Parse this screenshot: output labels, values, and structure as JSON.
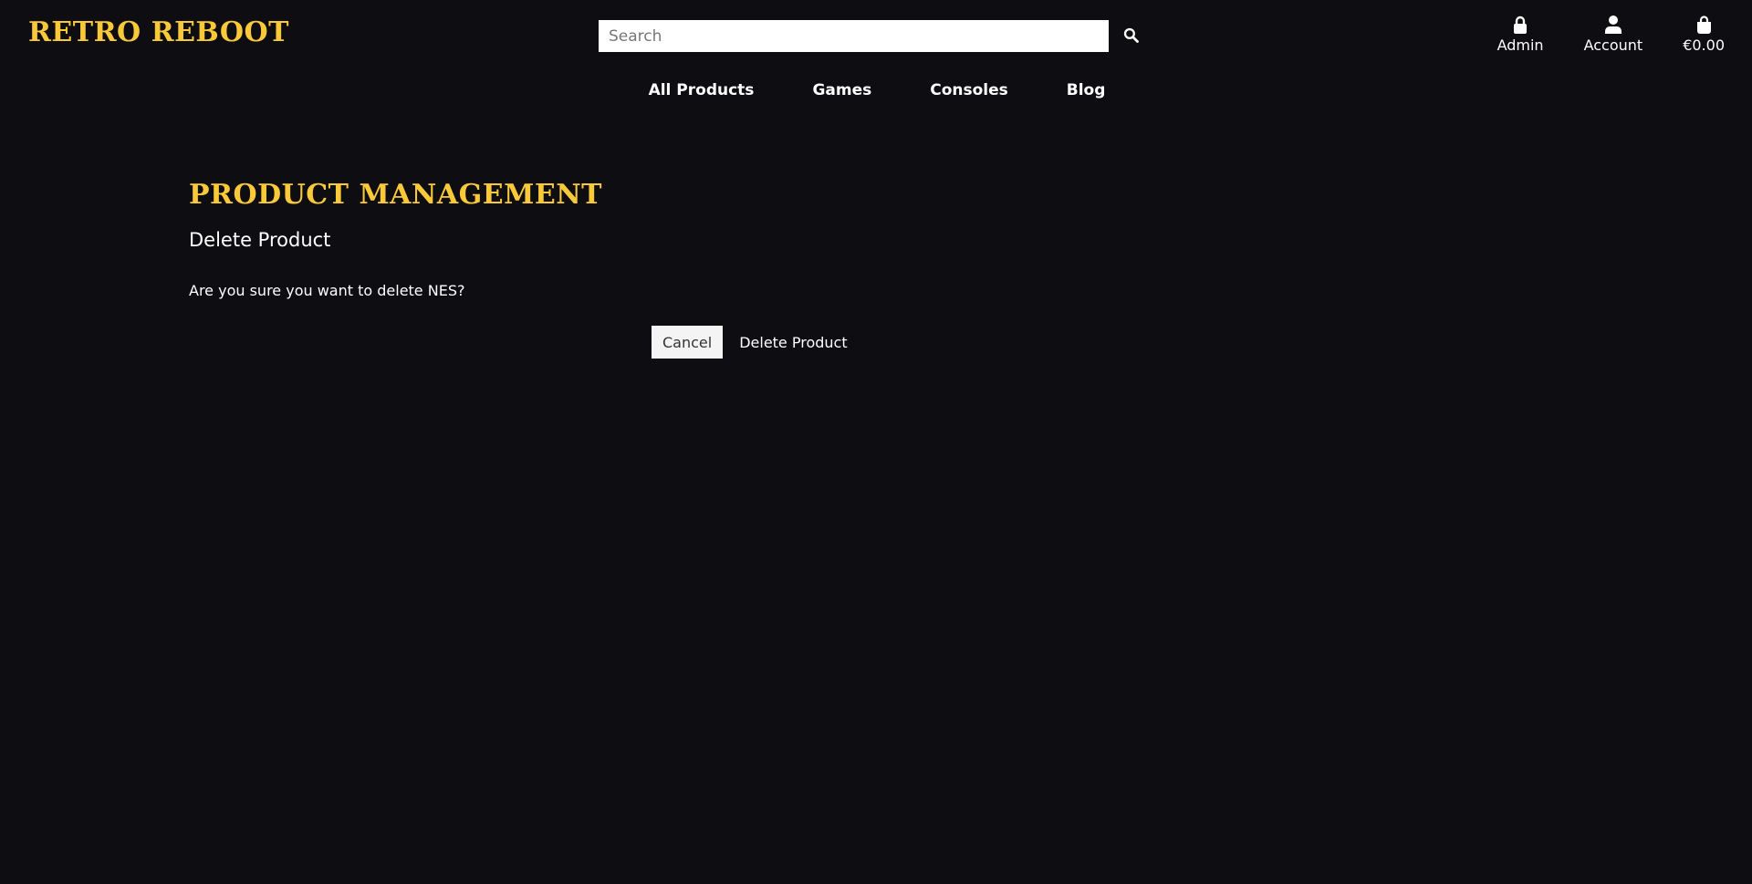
{
  "header": {
    "logo": "RETRO REBOOT",
    "search": {
      "placeholder": "Search",
      "value": "",
      "icon": "search-icon"
    },
    "links": [
      {
        "label": "Admin",
        "icon": "lock-icon"
      },
      {
        "label": "Account",
        "icon": "user-icon"
      },
      {
        "label": "€0.00",
        "icon": "shopping-bag-icon"
      }
    ]
  },
  "nav": {
    "items": [
      {
        "label": "All Products"
      },
      {
        "label": "Games"
      },
      {
        "label": "Consoles"
      },
      {
        "label": "Blog"
      }
    ]
  },
  "main": {
    "title": "PRODUCT MANAGEMENT",
    "subtitle": "Delete Product",
    "confirm_text": "Are you sure you want to delete NES?",
    "cancel_label": "Cancel",
    "delete_label": "Delete Product"
  },
  "colors": {
    "background": "#0d0d12",
    "accent": "#f9c93a",
    "text": "#ffffff"
  }
}
